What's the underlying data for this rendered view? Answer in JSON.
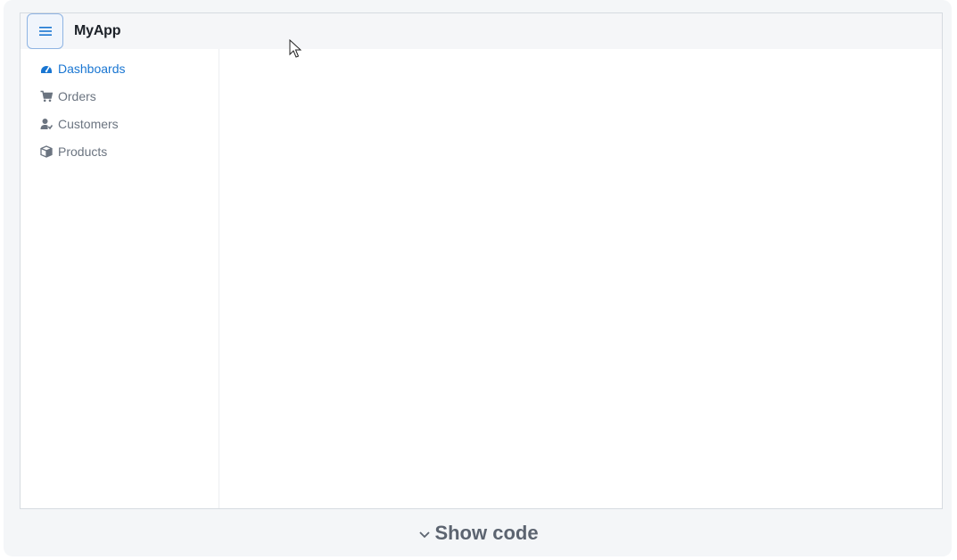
{
  "header": {
    "menu_icon": "hamburger-icon",
    "app_title": "MyApp"
  },
  "sidebar": {
    "items": [
      {
        "label": "Dashboards",
        "icon": "dashboard-icon",
        "active": true
      },
      {
        "label": "Orders",
        "icon": "cart-icon",
        "active": false
      },
      {
        "label": "Customers",
        "icon": "customer-icon",
        "active": false
      },
      {
        "label": "Products",
        "icon": "box-icon",
        "active": false
      }
    ]
  },
  "footer": {
    "show_code_label": "Show code",
    "chevron_icon": "chevron-down-icon"
  },
  "colors": {
    "accent": "#1976d2",
    "nav_text": "#6b7480",
    "header_bg": "#f5f6f8"
  }
}
